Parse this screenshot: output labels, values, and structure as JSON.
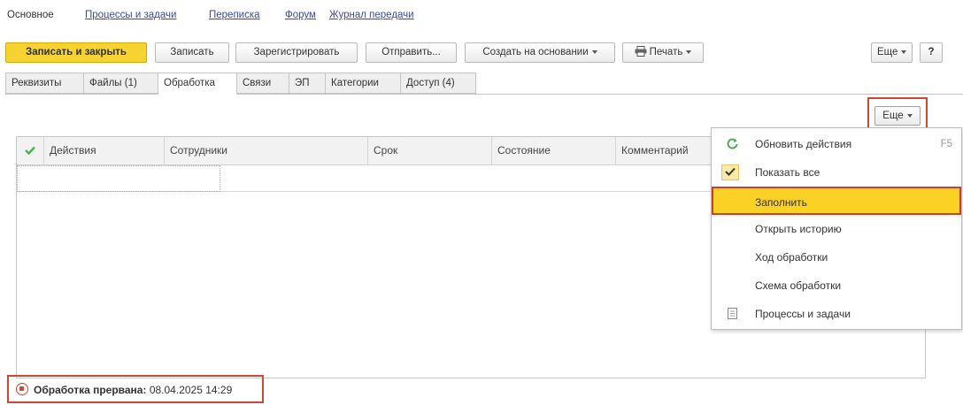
{
  "nav": {
    "items": [
      {
        "label": "Основное",
        "active": true
      },
      {
        "label": "Процессы и задачи"
      },
      {
        "label": "Переписка"
      },
      {
        "label": "Форум"
      },
      {
        "label": "Журнал передачи"
      }
    ]
  },
  "toolbar": {
    "save_close": "Записать и закрыть",
    "save": "Записать",
    "register": "Зарегистрировать",
    "send": "Отправить...",
    "create_based": "Создать на основании",
    "print": "Печать",
    "more": "Еще",
    "help": "?"
  },
  "tabs": [
    {
      "label": "Реквизиты"
    },
    {
      "label": "Файлы (1)"
    },
    {
      "label": "Обработка",
      "active": true
    },
    {
      "label": "Связи"
    },
    {
      "label": "ЭП"
    },
    {
      "label": "Категории"
    },
    {
      "label": "Доступ (4)"
    }
  ],
  "grid": {
    "columns": [
      "Действия",
      "Сотрудники",
      "Срок",
      "Состояние",
      "Комментарий"
    ],
    "more_label": "Еще"
  },
  "menu": {
    "items": [
      {
        "label": "Обновить действия",
        "shortcut": "F5",
        "icon": "refresh-icon"
      },
      {
        "label": "Показать все",
        "icon": "check-icon",
        "checked": true
      },
      {
        "label": "Заполнить",
        "selected": true
      },
      {
        "label": "Открыть историю"
      },
      {
        "label": "Ход обработки"
      },
      {
        "label": "Схема обработки"
      },
      {
        "label": "Процессы и задачи",
        "icon": "document-icon"
      }
    ]
  },
  "status": {
    "label": "Обработка прервана:",
    "datetime": "08.04.2025 14:29"
  },
  "colors": {
    "accent_yellow": "#f7d332",
    "highlight_red": "#d0462e",
    "link_blue": "#3a4aa0",
    "check_green": "#4caf50"
  }
}
